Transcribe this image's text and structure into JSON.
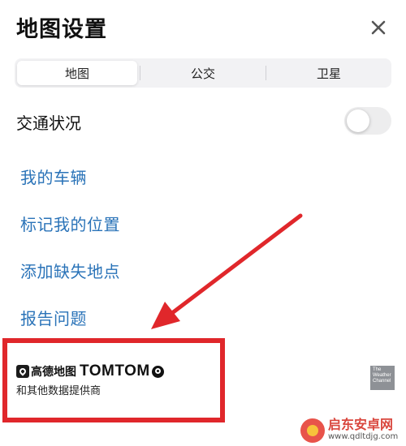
{
  "header": {
    "title": "地图设置",
    "close_icon": "close-icon"
  },
  "map_type_tabs": [
    {
      "label": "地图",
      "selected": true
    },
    {
      "label": "公交",
      "selected": false
    },
    {
      "label": "卫星",
      "selected": false
    }
  ],
  "traffic": {
    "label": "交通状况",
    "enabled": false
  },
  "links": {
    "my_vehicle": "我的车辆",
    "mark_my_location": "标记我的位置",
    "add_missing_place": "添加缺失地点",
    "report_issue": "报告问题"
  },
  "attribution": {
    "amap_name": "高德地图",
    "tomtom_name": "TOMTOM",
    "provider_text": "和其他数据提供商",
    "weather_logo_lines": [
      "The",
      "Weather",
      "Channel"
    ]
  },
  "annotation": {
    "highlight_color": "#e0272b",
    "arrow_color": "#e0272b"
  },
  "watermark": {
    "title": "启东安卓网",
    "url": "www.qdltdjg.com"
  },
  "colors": {
    "link": "#2a73b8",
    "text": "#111111"
  }
}
